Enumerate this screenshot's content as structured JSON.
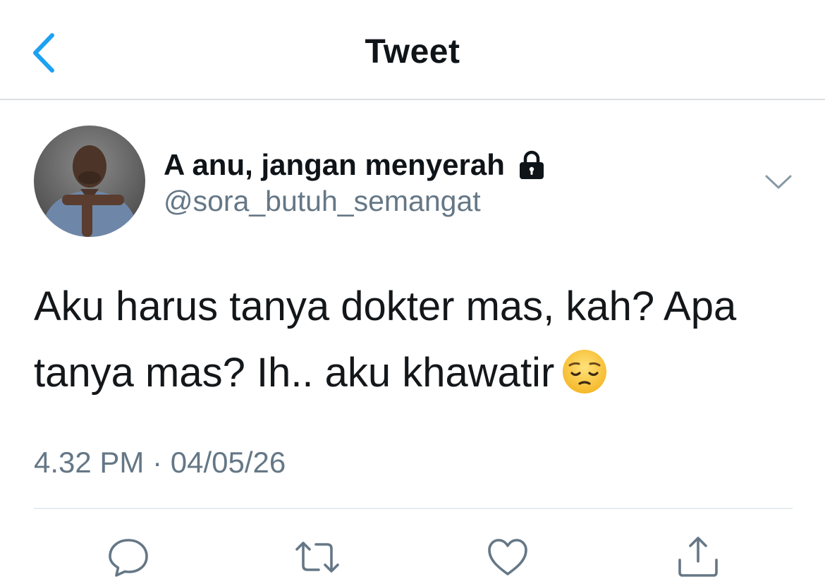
{
  "nav": {
    "title": "Tweet"
  },
  "tweet": {
    "display_name": "A anu, jangan menyerah",
    "handle": "@sora_butuh_semangat",
    "text": "Aku harus tanya dokter mas, kah? Apa tanya mas? Ih.. aku khawatir",
    "time": "4.32 PM · 04/05/26",
    "protected": true
  },
  "icons": {
    "back": "chevron-left-icon",
    "lock": "lock-icon",
    "more": "chevron-down-icon",
    "emoji": "pensive-face-emoji",
    "actions": [
      "reply-icon",
      "retweet-icon",
      "like-icon",
      "share-icon"
    ]
  },
  "colors": {
    "accent": "#1da1f2",
    "text": "#0f1419",
    "secondary": "#657786",
    "icon": "#657786",
    "divider": "#e6ecf0"
  }
}
